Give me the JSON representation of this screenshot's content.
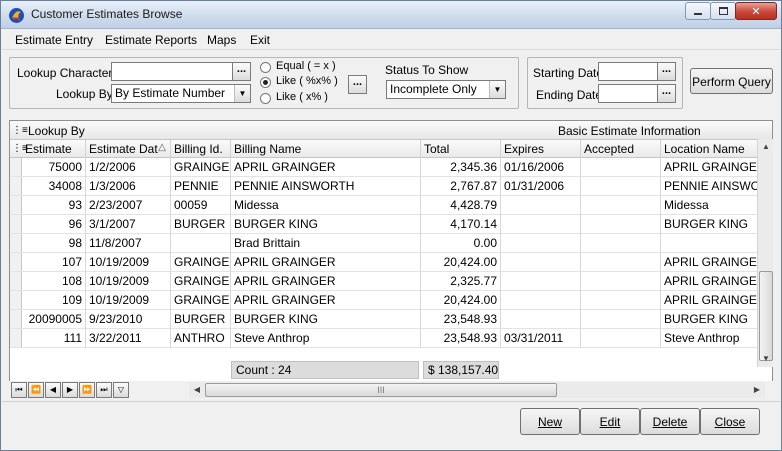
{
  "window": {
    "title": "Customer Estimates Browse",
    "controls": {
      "minimize": "▭",
      "maximize": "□",
      "close": "✕"
    }
  },
  "menu": [
    "Estimate Entry",
    "Estimate Reports",
    "Maps",
    "Exit"
  ],
  "filters": {
    "lookup_characters_label": "Lookup Characters",
    "lookup_characters_value": "",
    "lookup_by_label": "Lookup By",
    "lookup_by_value": "By Estimate Number",
    "match_options": [
      {
        "label": "Equal ( = x )",
        "checked": false
      },
      {
        "label": "Like ( %x% )",
        "checked": true
      },
      {
        "label": "Like ( x% )",
        "checked": false
      }
    ],
    "ellipsis": "...",
    "status_label": "Status To Show",
    "status_value": "Incomplete Only",
    "starting_date_label": "Starting Date",
    "starting_date_value": "",
    "ending_date_label": "Ending Date",
    "ending_date_value": "",
    "perform_query": "Perform Query"
  },
  "grid": {
    "band_left": "Lookup By",
    "band_right": "Basic Estimate Information",
    "columns": [
      "Estimate",
      "Estimate Dat",
      "Billing Id.",
      "Billing Name",
      "Total",
      "Expires",
      "Accepted",
      "Location Name"
    ],
    "sort_indicator": "△",
    "rows": [
      [
        "75000",
        "1/2/2006",
        "GRAINGEF",
        "APRIL GRAINGER",
        "2,345.36",
        "01/16/2006",
        "",
        "APRIL GRAINGER"
      ],
      [
        "34008",
        "1/3/2006",
        "PENNIE",
        "PENNIE AINSWORTH",
        "2,767.87",
        "01/31/2006",
        "",
        "PENNIE AINSWOR"
      ],
      [
        "93",
        "2/23/2007",
        "00059",
        "Midessa",
        "4,428.79",
        "",
        "",
        "Midessa"
      ],
      [
        "96",
        "3/1/2007",
        "BURGER",
        "BURGER KING",
        "4,170.14",
        "",
        "",
        "BURGER KING"
      ],
      [
        "98",
        "11/8/2007",
        "",
        "Brad Brittain",
        "0.00",
        "",
        "",
        ""
      ],
      [
        "107",
        "10/19/2009",
        "GRAINGEF",
        "APRIL GRAINGER",
        "20,424.00",
        "",
        "",
        "APRIL GRAINGER"
      ],
      [
        "108",
        "10/19/2009",
        "GRAINGEF",
        "APRIL GRAINGER",
        "2,325.77",
        "",
        "",
        "APRIL GRAINGER"
      ],
      [
        "109",
        "10/19/2009",
        "GRAINGEF",
        "APRIL GRAINGER",
        "20,424.00",
        "",
        "",
        "APRIL GRAINGER"
      ],
      [
        "20090005",
        "9/23/2010",
        "BURGER",
        "BURGER KING",
        "23,548.93",
        "",
        "",
        "BURGER KING"
      ],
      [
        "111",
        "3/22/2011",
        "ANTHRO",
        "Steve Anthrop",
        "23,548.93",
        "03/31/2011",
        "",
        "Steve Anthrop"
      ]
    ],
    "count_text": "Count : 24",
    "total_text": "$ 138,157.40"
  },
  "navigator": [
    "⏮",
    "⏪",
    "◀",
    "▶",
    "⏩",
    "⏭",
    "▽"
  ],
  "hscroll_grip": "III",
  "buttons": {
    "new": "New",
    "edit": "Edit",
    "delete": "Delete",
    "close": "Close"
  }
}
